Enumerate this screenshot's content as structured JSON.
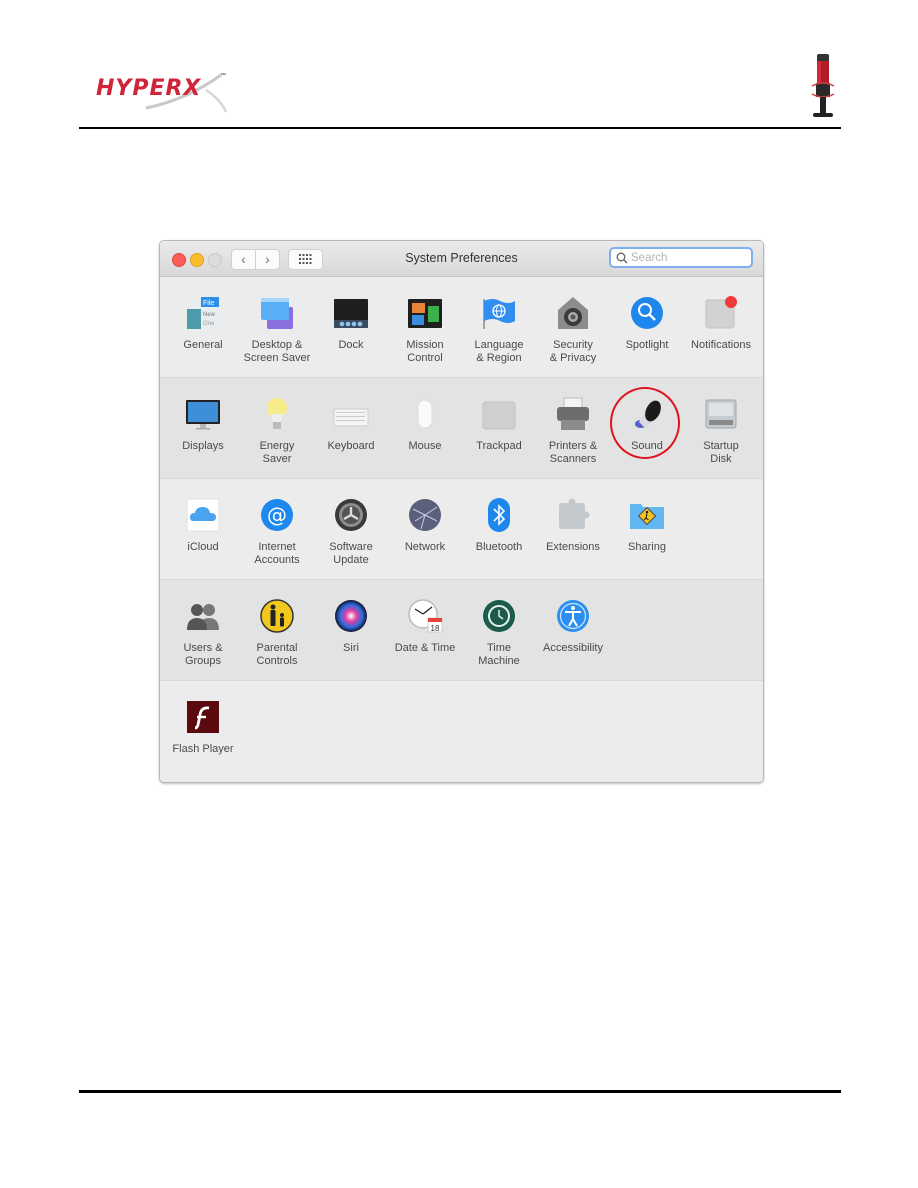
{
  "document": {
    "brand": "HYPERX",
    "brand_tm": "™",
    "brand_color": "#d0243a",
    "highlight_color": "#e0141e"
  },
  "window": {
    "title": "System Preferences",
    "search": {
      "placeholder": "Search",
      "value": ""
    },
    "nav": {
      "back_icon": "‹",
      "forward_icon": "›"
    },
    "rows": [
      {
        "shade": "light",
        "items": [
          {
            "label": "General",
            "icon": "general-icon"
          },
          {
            "label": "Desktop &\nScreen Saver",
            "icon": "desktop-screensaver-icon"
          },
          {
            "label": "Dock",
            "icon": "dock-icon"
          },
          {
            "label": "Mission\nControl",
            "icon": "mission-control-icon"
          },
          {
            "label": "Language\n& Region",
            "icon": "language-region-icon"
          },
          {
            "label": "Security\n& Privacy",
            "icon": "security-privacy-icon"
          },
          {
            "label": "Spotlight",
            "icon": "spotlight-icon"
          },
          {
            "label": "Notifications",
            "icon": "notifications-icon"
          }
        ]
      },
      {
        "shade": "dark",
        "items": [
          {
            "label": "Displays",
            "icon": "displays-icon"
          },
          {
            "label": "Energy\nSaver",
            "icon": "energy-saver-icon"
          },
          {
            "label": "Keyboard",
            "icon": "keyboard-icon"
          },
          {
            "label": "Mouse",
            "icon": "mouse-icon"
          },
          {
            "label": "Trackpad",
            "icon": "trackpad-icon"
          },
          {
            "label": "Printers &\nScanners",
            "icon": "printers-scanners-icon"
          },
          {
            "label": "Sound",
            "icon": "sound-icon",
            "highlighted": true
          },
          {
            "label": "Startup\nDisk",
            "icon": "startup-disk-icon"
          }
        ]
      },
      {
        "shade": "light",
        "items": [
          {
            "label": "iCloud",
            "icon": "icloud-icon"
          },
          {
            "label": "Internet\nAccounts",
            "icon": "internet-accounts-icon"
          },
          {
            "label": "Software\nUpdate",
            "icon": "software-update-icon"
          },
          {
            "label": "Network",
            "icon": "network-icon"
          },
          {
            "label": "Bluetooth",
            "icon": "bluetooth-icon"
          },
          {
            "label": "Extensions",
            "icon": "extensions-icon"
          },
          {
            "label": "Sharing",
            "icon": "sharing-icon"
          }
        ]
      },
      {
        "shade": "dark",
        "items": [
          {
            "label": "Users &\nGroups",
            "icon": "users-groups-icon"
          },
          {
            "label": "Parental\nControls",
            "icon": "parental-controls-icon"
          },
          {
            "label": "Siri",
            "icon": "siri-icon"
          },
          {
            "label": "Date & Time",
            "icon": "date-time-icon"
          },
          {
            "label": "Time\nMachine",
            "icon": "time-machine-icon"
          },
          {
            "label": "Accessibility",
            "icon": "accessibility-icon"
          }
        ]
      },
      {
        "shade": "light",
        "items": [
          {
            "label": "Flash Player",
            "icon": "flash-player-icon"
          }
        ]
      }
    ],
    "calendar_day": "18"
  }
}
